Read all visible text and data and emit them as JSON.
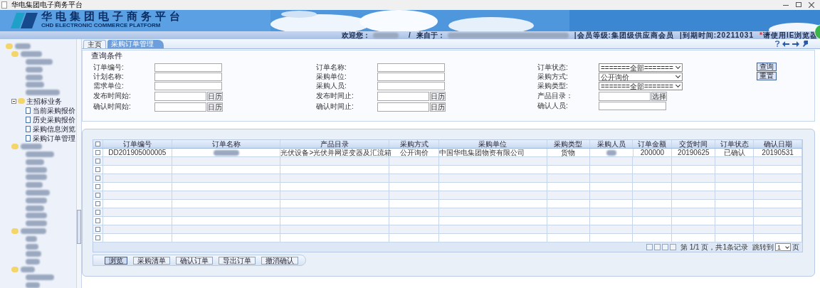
{
  "window": {
    "title": "华电集团电子商务平台"
  },
  "header": {
    "title": "华电集团电子商务平台",
    "subtitle": "CHD ELECTRONIC COMMERCE PLATFORM"
  },
  "user_bar": {
    "welcome_label": "欢迎您：",
    "separator": "/",
    "from_label": "来自于：",
    "member_level": "|会员等级:集团级供应商会员",
    "expiry": "|到期时间:20211031",
    "notice_mark": "*",
    "notice": "请使用IE浏览器"
  },
  "tabs": [
    {
      "label": "主页",
      "selected": false
    },
    {
      "label": "采购订单管理",
      "selected": true
    }
  ],
  "sidebar": {
    "items": [
      {
        "label": "主招标业务",
        "expanded": true,
        "children": [
          {
            "label": "当前采购报价"
          },
          {
            "label": "历史采购报价"
          },
          {
            "label": "采购信息浏览"
          },
          {
            "label": "采购订单管理"
          }
        ]
      }
    ]
  },
  "query": {
    "title": "查询条件",
    "columns": [
      [
        {
          "label": "订单编号:",
          "kind": "text"
        },
        {
          "label": "计划名称:",
          "kind": "text"
        },
        {
          "label": "需求单位:",
          "kind": "text"
        },
        {
          "label": "发布时间始:",
          "kind": "date",
          "button": "日历"
        },
        {
          "label": "确认时间始:",
          "kind": "date",
          "button": "日历"
        }
      ],
      [
        {
          "label": "订单名称:",
          "kind": "text"
        },
        {
          "label": "采购单位:",
          "kind": "text"
        },
        {
          "label": "采购人员:",
          "kind": "text"
        },
        {
          "label": "发布时间止:",
          "kind": "date",
          "button": "日历"
        },
        {
          "label": "确认时间止:",
          "kind": "date",
          "button": "日历"
        }
      ],
      [
        {
          "label": "订单状态:",
          "kind": "select",
          "value": "=======全部======="
        },
        {
          "label": "采购方式:",
          "kind": "select",
          "value": "公开询价"
        },
        {
          "label": "采购类型:",
          "kind": "select",
          "value": "=======全部======="
        },
        {
          "label": "产品目录：",
          "kind": "date",
          "button": "选择"
        },
        {
          "label": "确认人员:",
          "kind": "text"
        }
      ]
    ],
    "buttons": [
      "查询",
      "重置"
    ]
  },
  "table": {
    "select_all": {
      "checked": false
    },
    "empty_rows": [
      {
        "checked": false
      },
      {
        "checked": false
      },
      {
        "checked": false
      },
      {
        "checked": false
      },
      {
        "checked": false
      },
      {
        "checked": false
      },
      {
        "checked": false
      },
      {
        "checked": false
      },
      {
        "checked": false
      },
      {
        "checked": false
      }
    ],
    "columns": [
      "订单编号",
      "订单名称",
      "产品目录",
      "采购方式",
      "采购单位",
      "采购类型",
      "采购人员",
      "订单金额",
      "交货时间",
      "订单状态",
      "确认日期"
    ],
    "rows": [
      {
        "checked": false,
        "cells": [
          "DD201905000005",
          {
            "kind": "redacted"
          },
          "光伏设备>光伏并网逆变器及汇流箱",
          "公开询价",
          "中国华电集团物资有限公司",
          "货物",
          {
            "kind": "redacted"
          },
          "200000",
          "20190625",
          "已确认",
          "20190531"
        ]
      }
    ]
  },
  "pagination": {
    "info": "第 1/1 页，共1条记录",
    "goto_label": "跳转到",
    "page": "1",
    "page_suffix": "页"
  },
  "actions": [
    {
      "label": "浏览",
      "selected": true
    },
    {
      "label": "采购清单",
      "selected": false
    },
    {
      "label": "确认订单",
      "selected": false
    },
    {
      "label": "导出订单",
      "selected": false
    },
    {
      "label": "撤消确认",
      "selected": false
    }
  ]
}
